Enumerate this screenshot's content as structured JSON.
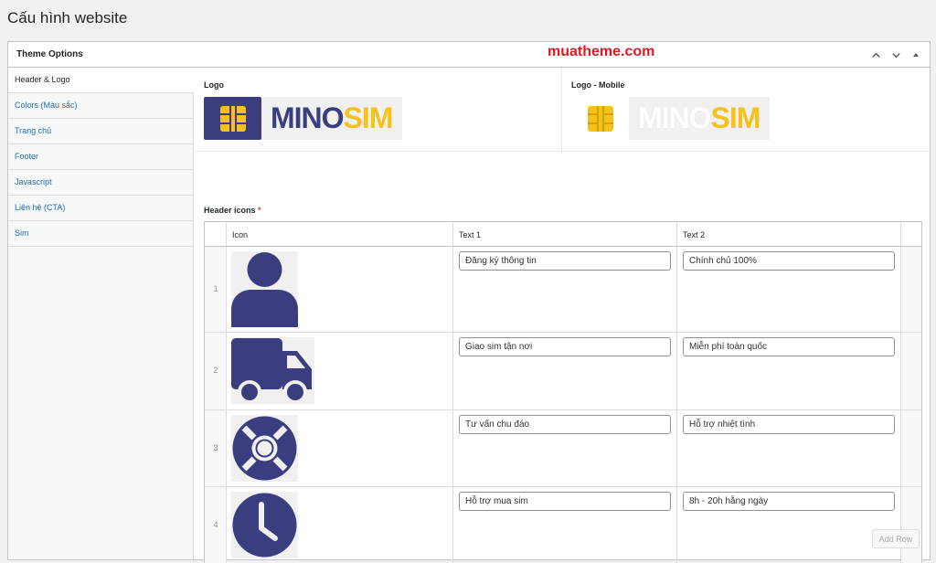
{
  "page": {
    "title": "Cấu hình website"
  },
  "postbox": {
    "title": "Theme Options",
    "watermark": "muatheme.com",
    "actions": {
      "move_up": "chevron-up-icon",
      "move_down": "chevron-down-icon",
      "toggle": "triangle-up-icon"
    }
  },
  "tabs": [
    {
      "label": "Header & Logo",
      "active": true
    },
    {
      "label": "Colors (Màu sắc)"
    },
    {
      "label": "Trang chủ"
    },
    {
      "label": "Footer"
    },
    {
      "label": "Javascript"
    },
    {
      "label": "Liên hệ (CTA)"
    },
    {
      "label": "Sim"
    }
  ],
  "logo": {
    "label": "Logo",
    "text_part1": "MINO",
    "text_part2": "SIM"
  },
  "logo_mobile": {
    "label": "Logo - Mobile",
    "text_part1": "MINO",
    "text_part2": "SIM"
  },
  "header_icons": {
    "label": "Header icons",
    "required_mark": "*",
    "columns": {
      "icon": "Icon",
      "text1": "Text 1",
      "text2": "Text 2"
    },
    "rows": [
      {
        "num": "1",
        "icon": "user-icon",
        "text1": "Đăng ký thông tin",
        "text2": "Chính chủ 100%"
      },
      {
        "num": "2",
        "icon": "truck-icon",
        "text1": "Giao sim tận nơi",
        "text2": "Miễn phí toàn quốc"
      },
      {
        "num": "3",
        "icon": "lifebuoy-icon",
        "text1": "Tư vấn chu đáo",
        "text2": "Hỗ trợ nhiệt tình"
      },
      {
        "num": "4",
        "icon": "clock-icon",
        "text1": "Hỗ trợ mua sim",
        "text2": "8h - 20h hằng ngày"
      }
    ],
    "add_row_label": "Add Row"
  },
  "colors": {
    "accent": "#3a3e7e",
    "brand_yellow": "#f5c21b",
    "watermark_red": "#e0191f",
    "link": "#2271b1"
  }
}
